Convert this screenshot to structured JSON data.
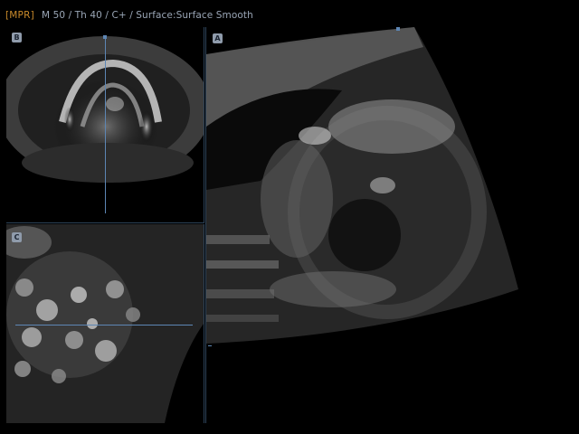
{
  "header": {
    "mode": "[MPR]",
    "params": "M 50 / Th 40 / C+ / Surface:Surface Smooth"
  },
  "panes": {
    "b": {
      "label": "B"
    },
    "c": {
      "label": "C"
    },
    "a": {
      "label": "A"
    }
  },
  "colors": {
    "mode_tag": "#c98a2b",
    "param_text": "#9aa6b6",
    "cursor": "#5d86b4",
    "label_bg": "#8f9bab",
    "divider": "#2d4359"
  }
}
